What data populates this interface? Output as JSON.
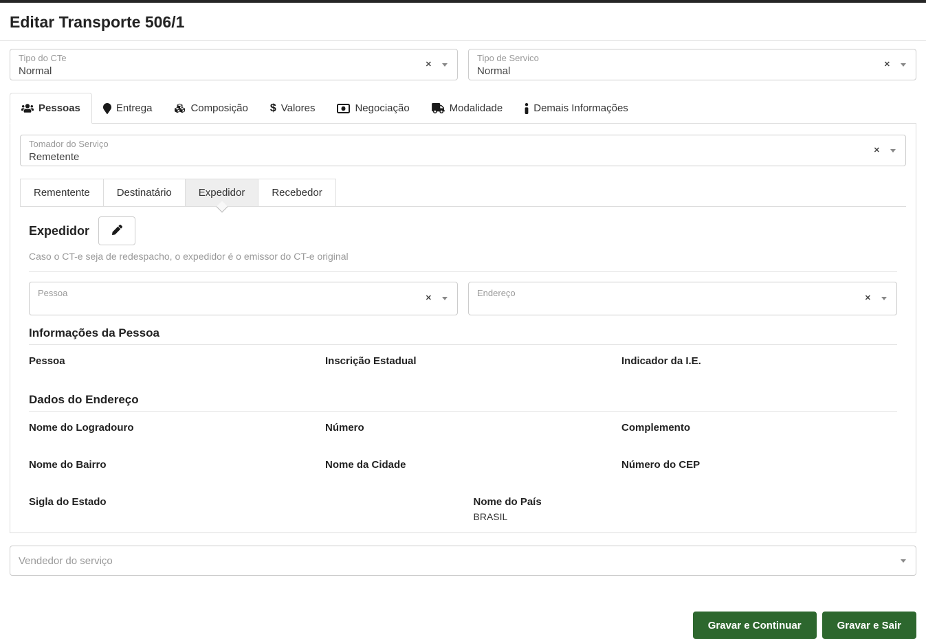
{
  "title": "Editar Transporte 506/1",
  "top_selects": {
    "tipo_cte": {
      "label": "Tipo do CTe",
      "value": "Normal"
    },
    "tipo_servico": {
      "label": "Tipo de Servico",
      "value": "Normal"
    }
  },
  "tabs": [
    "Pessoas",
    "Entrega",
    "Composição",
    "Valores",
    "Negociação",
    "Modalidade",
    "Demais Informações"
  ],
  "tomador": {
    "label": "Tomador do Serviço",
    "value": "Remetente"
  },
  "subtabs": [
    "Rementente",
    "Destinatário",
    "Expedidor",
    "Recebedor"
  ],
  "expedidor": {
    "title": "Expedidor",
    "helper": "Caso o CT-e seja de redespacho, o expedidor é o emissor do CT-e original",
    "pessoa_select_label": "Pessoa",
    "endereco_select_label": "Endereço",
    "info_pessoa": {
      "title": "Informações da Pessoa",
      "fields": [
        {
          "label": "Pessoa",
          "value": ""
        },
        {
          "label": "Inscrição Estadual",
          "value": ""
        },
        {
          "label": "Indicador da I.E.",
          "value": ""
        }
      ]
    },
    "dados_endereco": {
      "title": "Dados do Endereço",
      "fields": [
        {
          "label": "Nome do Logradouro",
          "value": ""
        },
        {
          "label": "Número",
          "value": ""
        },
        {
          "label": "Complemento",
          "value": ""
        },
        {
          "label": "Nome do Bairro",
          "value": ""
        },
        {
          "label": "Nome da Cidade",
          "value": ""
        },
        {
          "label": "Número do CEP",
          "value": ""
        },
        {
          "label": "Sigla do Estado",
          "value": ""
        },
        {
          "label": "Nome do País",
          "value": "BRASIL"
        }
      ]
    }
  },
  "vendedor": {
    "placeholder": "Vendedor do serviço"
  },
  "actions": {
    "continue": "Gravar e Continuar",
    "exit": "Gravar e Sair"
  },
  "icons": {
    "clear": "✕",
    "dollar": "$"
  },
  "colors": {
    "accent_green": "#2d672e",
    "topbar": "#262626"
  }
}
